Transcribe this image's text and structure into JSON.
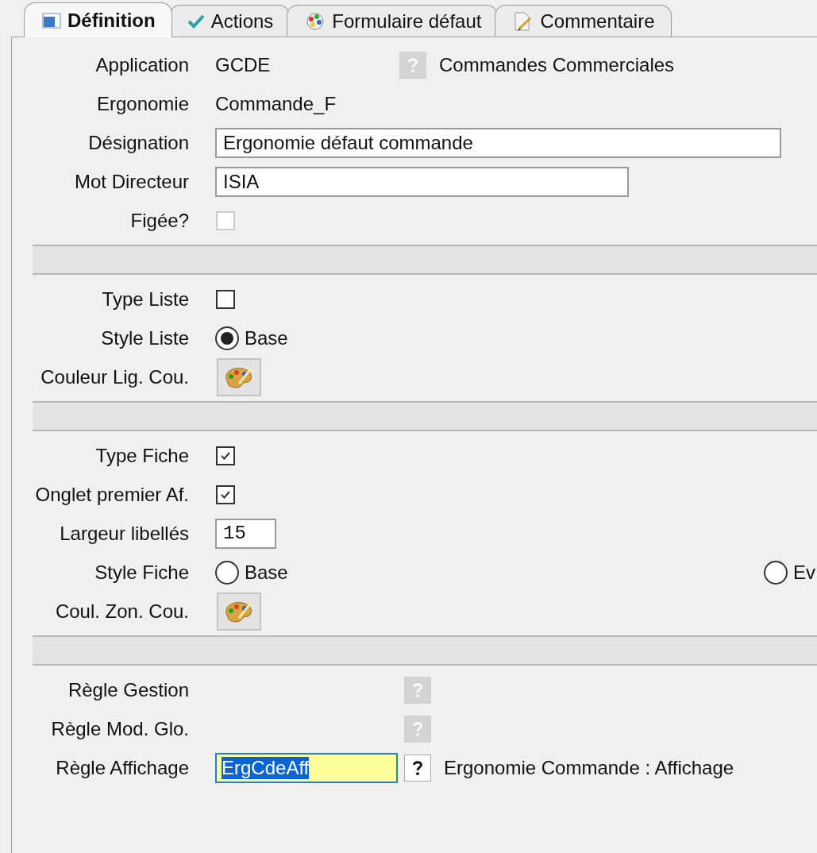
{
  "tabs": [
    {
      "label": "Définition",
      "selected": true
    },
    {
      "label": "Actions",
      "selected": false
    },
    {
      "label": "Formulaire défaut",
      "selected": false
    },
    {
      "label": "Commentaire",
      "selected": false
    }
  ],
  "rows": [
    {
      "kind": "value",
      "label": "Application",
      "value": "GCDE",
      "help": {
        "disabled": true
      },
      "description": "Commandes Commerciales"
    },
    {
      "kind": "value",
      "label": "Ergonomie",
      "value": "Commande_F"
    },
    {
      "kind": "wide-field",
      "label": "Désignation",
      "value": "Ergonomie défaut commande"
    },
    {
      "kind": "field",
      "label": "Mot Directeur",
      "value": "ISIA"
    },
    {
      "kind": "checkbox",
      "label": "Figée?",
      "checked": false,
      "disabled": true
    },
    {
      "kind": "separator"
    },
    {
      "kind": "checkbox",
      "label": "Type Liste",
      "checked": false,
      "disabled": false
    },
    {
      "kind": "radio",
      "label": "Style Liste",
      "options": [
        {
          "label": "Base",
          "selected": true
        }
      ]
    },
    {
      "kind": "color",
      "label": "Couleur Lig. Cou."
    },
    {
      "kind": "separator"
    },
    {
      "kind": "checkbox",
      "label": "Type Fiche",
      "checked": true,
      "disabled": false
    },
    {
      "kind": "checkbox",
      "label": "Onglet premier Af.",
      "checked": true,
      "disabled": false
    },
    {
      "kind": "number-field",
      "label": "Largeur libellés",
      "value": "15"
    },
    {
      "kind": "radio",
      "label": "Style Fiche",
      "options": [
        {
          "label": "Base",
          "selected": false
        },
        {
          "label": "Ev",
          "selected": false
        }
      ]
    },
    {
      "kind": "color",
      "label": "Coul. Zon. Cou."
    },
    {
      "kind": "separator"
    },
    {
      "kind": "lookup",
      "label": "Règle Gestion",
      "help": {
        "disabled": true
      }
    },
    {
      "kind": "lookup",
      "label": "Règle Mod. Glo.",
      "help": {
        "disabled": true
      }
    },
    {
      "kind": "lookup",
      "label": "Règle Affichage",
      "value": "ErgCdeAff",
      "focused": true,
      "help": {
        "disabled": false
      },
      "description": "Ergonomie Commande : Affichage"
    }
  ]
}
